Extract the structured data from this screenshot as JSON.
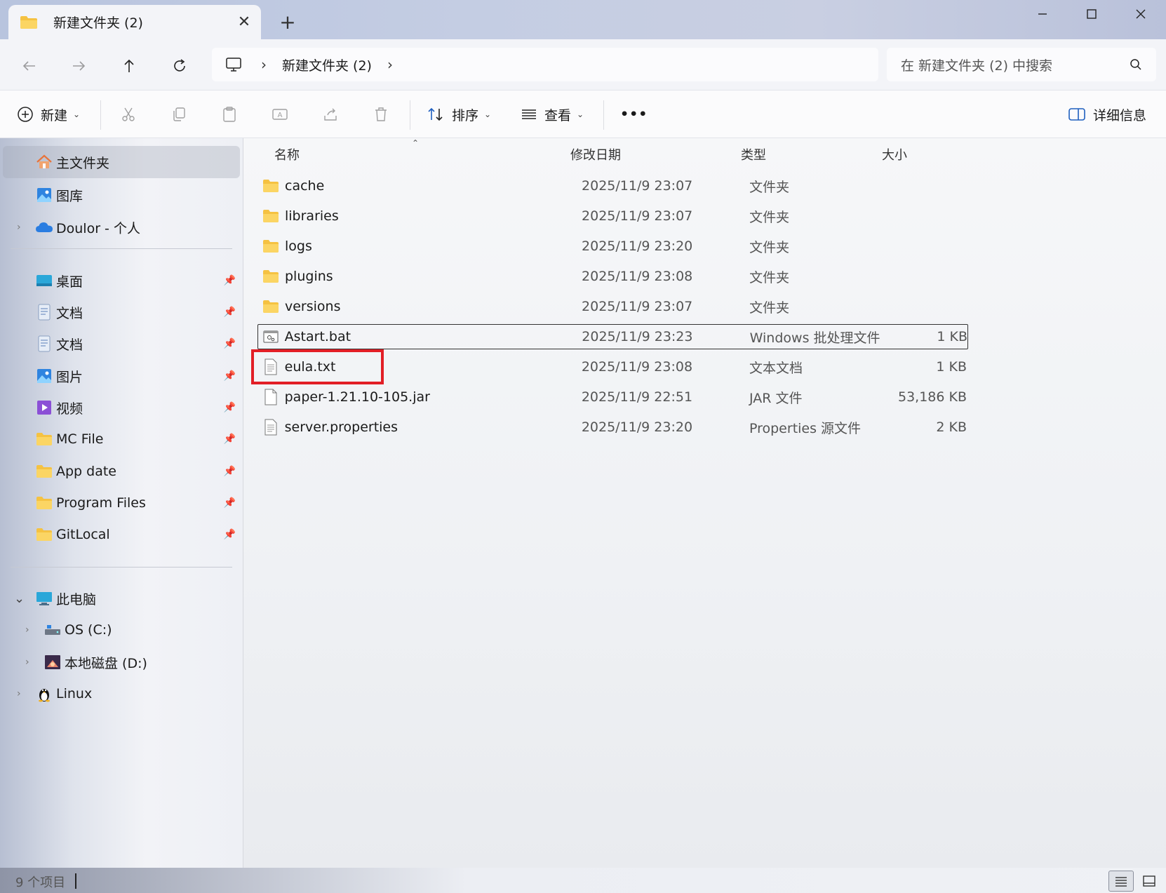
{
  "window": {
    "tab_title": "新建文件夹 (2)",
    "tab_close": "✕",
    "new_tab": "+",
    "minimize": "—",
    "maximize": "☐",
    "close": "✕"
  },
  "nav": {
    "address_crumb": "新建文件夹 (2)",
    "search_placeholder": "在 新建文件夹 (2) 中搜索"
  },
  "toolbar": {
    "new_label": "新建",
    "sort_label": "排序",
    "view_label": "查看",
    "more_label": "•••",
    "details_label": "详细信息"
  },
  "sidebar": {
    "items": [
      {
        "label": "主文件夹",
        "icon": "home-icon",
        "selected": true
      },
      {
        "label": "图库",
        "icon": "gallery-icon"
      },
      {
        "label": "Doulor - 个人",
        "icon": "onedrive-icon"
      },
      {
        "label": "桌面",
        "icon": "desktop-icon",
        "pinned": true
      },
      {
        "label": "文档",
        "icon": "document-icon",
        "pinned": true
      },
      {
        "label": "文档",
        "icon": "document-icon",
        "pinned": true
      },
      {
        "label": "图片",
        "icon": "pictures-icon",
        "pinned": true
      },
      {
        "label": "视频",
        "icon": "videos-icon",
        "pinned": true
      },
      {
        "label": "MC File",
        "icon": "folder-icon",
        "pinned": true
      },
      {
        "label": "App date",
        "icon": "folder-icon",
        "pinned": true
      },
      {
        "label": "Program Files",
        "icon": "folder-icon",
        "pinned": true
      },
      {
        "label": "GitLocal",
        "icon": "folder-icon",
        "pinned": true
      },
      {
        "label": "此电脑",
        "icon": "computer-icon",
        "expanded": true
      },
      {
        "label": "OS (C:)",
        "icon": "drive-icon"
      },
      {
        "label": "本地磁盘 (D:)",
        "icon": "drive-icon"
      },
      {
        "label": "Linux",
        "icon": "linux-icon"
      }
    ]
  },
  "columns": {
    "name": "名称",
    "date": "修改日期",
    "type": "类型",
    "size": "大小"
  },
  "files": [
    {
      "name": "cache",
      "date": "2025/11/9 23:07",
      "type": "文件夹",
      "size": "",
      "icon": "folder-icon"
    },
    {
      "name": "libraries",
      "date": "2025/11/9 23:07",
      "type": "文件夹",
      "size": "",
      "icon": "folder-icon"
    },
    {
      "name": "logs",
      "date": "2025/11/9 23:20",
      "type": "文件夹",
      "size": "",
      "icon": "folder-icon"
    },
    {
      "name": "plugins",
      "date": "2025/11/9 23:08",
      "type": "文件夹",
      "size": "",
      "icon": "folder-icon"
    },
    {
      "name": "versions",
      "date": "2025/11/9 23:07",
      "type": "文件夹",
      "size": "",
      "icon": "folder-icon"
    },
    {
      "name": "Astart.bat",
      "date": "2025/11/9 23:23",
      "type": "Windows 批处理文件",
      "size": "1 KB",
      "icon": "batch-file-icon"
    },
    {
      "name": "eula.txt",
      "date": "2025/11/9 23:08",
      "type": "文本文档",
      "size": "1 KB",
      "icon": "text-file-icon"
    },
    {
      "name": "paper-1.21.10-105.jar",
      "date": "2025/11/9 22:51",
      "type": "JAR 文件",
      "size": "53,186 KB",
      "icon": "file-icon"
    },
    {
      "name": "server.properties",
      "date": "2025/11/9 23:20",
      "type": "Properties 源文件",
      "size": "2 KB",
      "icon": "text-file-icon"
    }
  ],
  "status": {
    "item_count": "9 个项目"
  },
  "colors": {
    "folder": "#f5c242",
    "highlight": "#e21f26",
    "accent": "#2a6fd6"
  }
}
